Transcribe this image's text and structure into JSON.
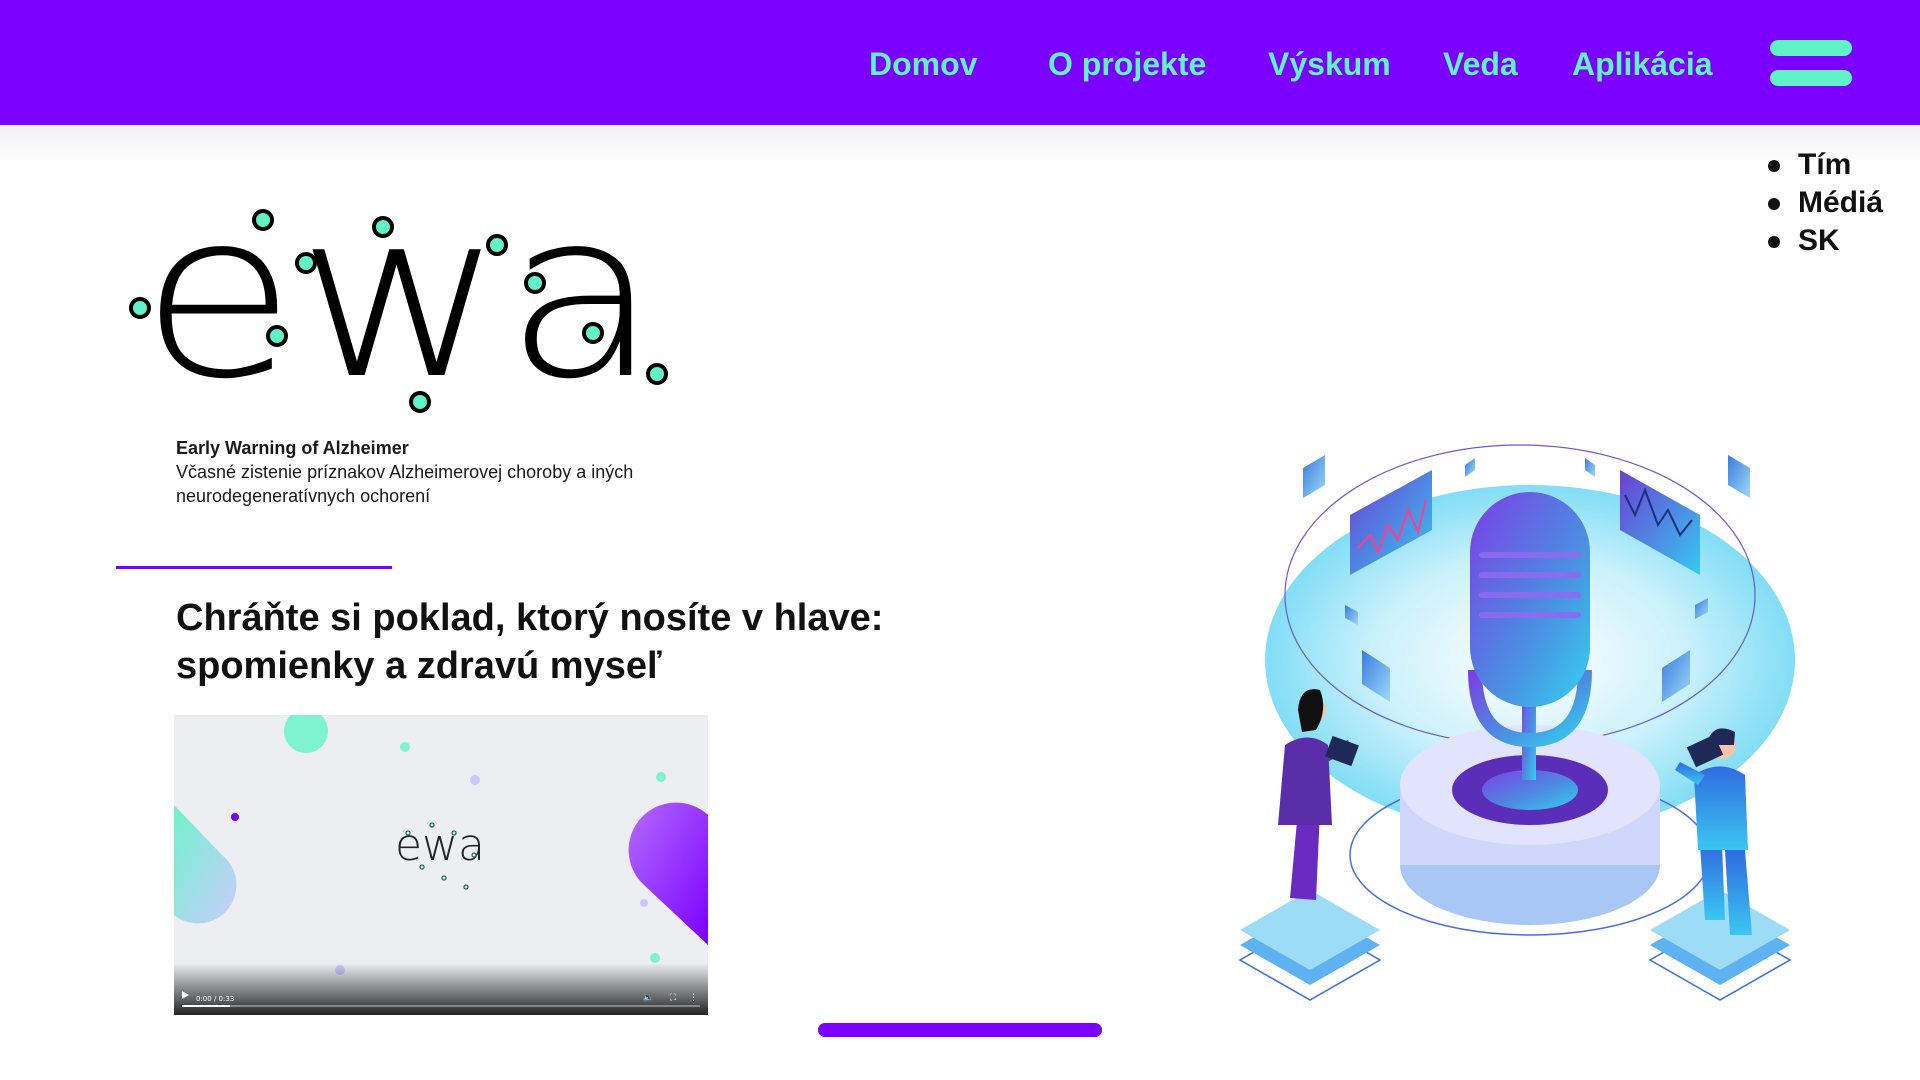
{
  "nav": {
    "items": [
      "Domov",
      "O projekte",
      "Výskum",
      "Veda",
      "Aplikácia"
    ]
  },
  "menu": {
    "toggle_icon": "hamburger-icon",
    "submenu": [
      "Tím",
      "Médiá",
      "SK"
    ]
  },
  "logo": {
    "text": "ewa"
  },
  "tagline": {
    "title": "Early Warning of Alzheimer",
    "subtitle": "Včasné zistenie príznakov Alzheimerovej choroby a iných neurodegeneratívnych ochorení"
  },
  "headline": "Chráňte si poklad, ktorý nosíte v hlave: spomienky a zdravú myseľ",
  "video": {
    "logo_text": "ewa",
    "time": "0:00 / 0:33",
    "progress": 0
  },
  "colors": {
    "brand": "#7B00FF",
    "accent": "#62F2C7"
  }
}
